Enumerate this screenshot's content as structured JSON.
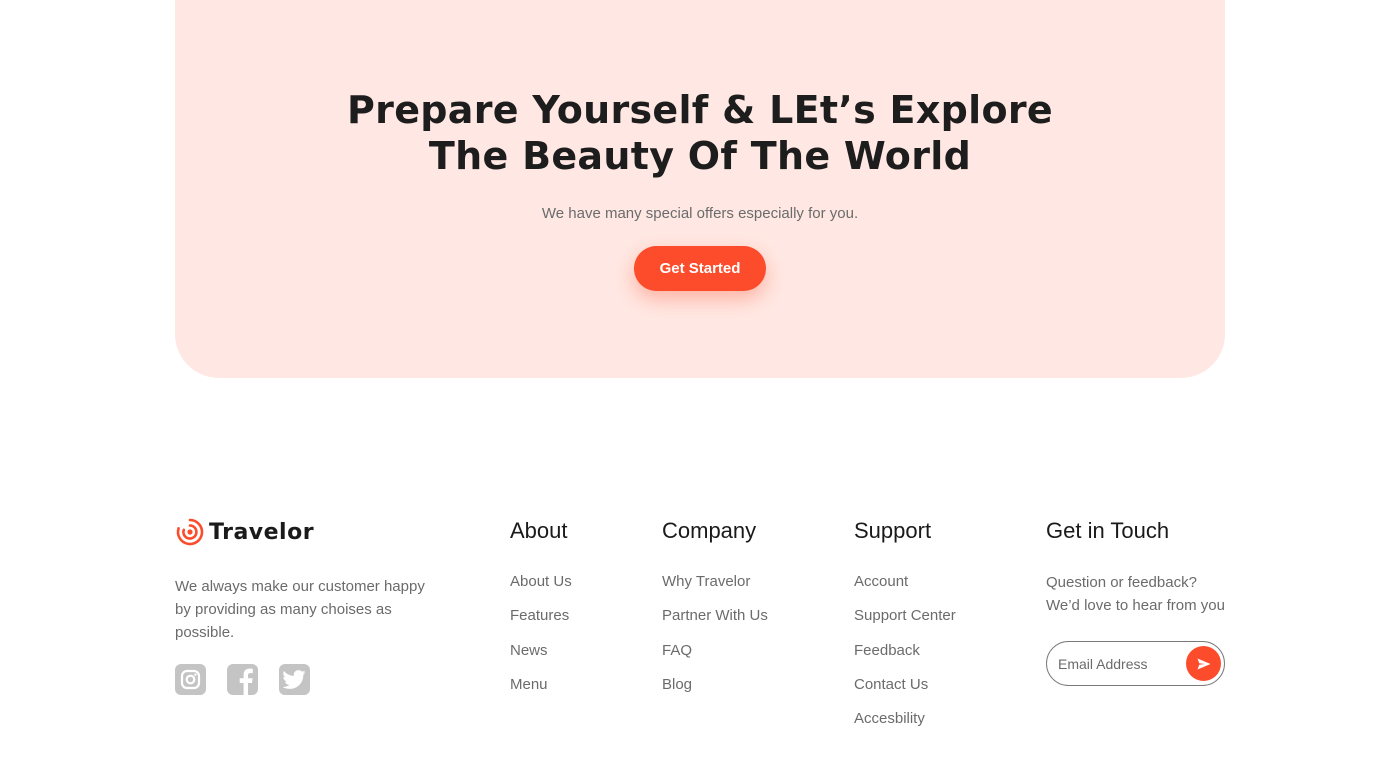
{
  "cta": {
    "title_line1": "Prepare Yourself & LEt’s Explore",
    "title_line2": "The Beauty Of The World",
    "subtitle": "We have many special offers especially for you.",
    "button_label": "Get Started"
  },
  "brand": {
    "name": "Travelor",
    "description": "We always make our customer happy by providing as many choises as possible.",
    "social_icons": [
      "instagram-icon",
      "facebook-icon",
      "twitter-icon"
    ]
  },
  "footer": {
    "about": {
      "title": "About",
      "links": [
        "About Us",
        "Features",
        "News",
        "Menu"
      ]
    },
    "company": {
      "title": "Company",
      "links": [
        "Why Travelor",
        "Partner With Us",
        "FAQ",
        "Blog"
      ]
    },
    "support": {
      "title": "Support",
      "links": [
        "Account",
        "Support Center",
        "Feedback",
        "Contact Us",
        "Accesbility"
      ]
    },
    "touch": {
      "title": "Get in Touch",
      "line1": "Question or feedback?",
      "line2": "We’d love to hear from you",
      "email_placeholder": "Email Address",
      "send_icon": "send-icon"
    }
  },
  "colors": {
    "accent": "#fc4c2b",
    "cta_background": "#ffe8e3",
    "muted_text": "#6b6b6b",
    "social_icon": "#c4c4c4"
  }
}
